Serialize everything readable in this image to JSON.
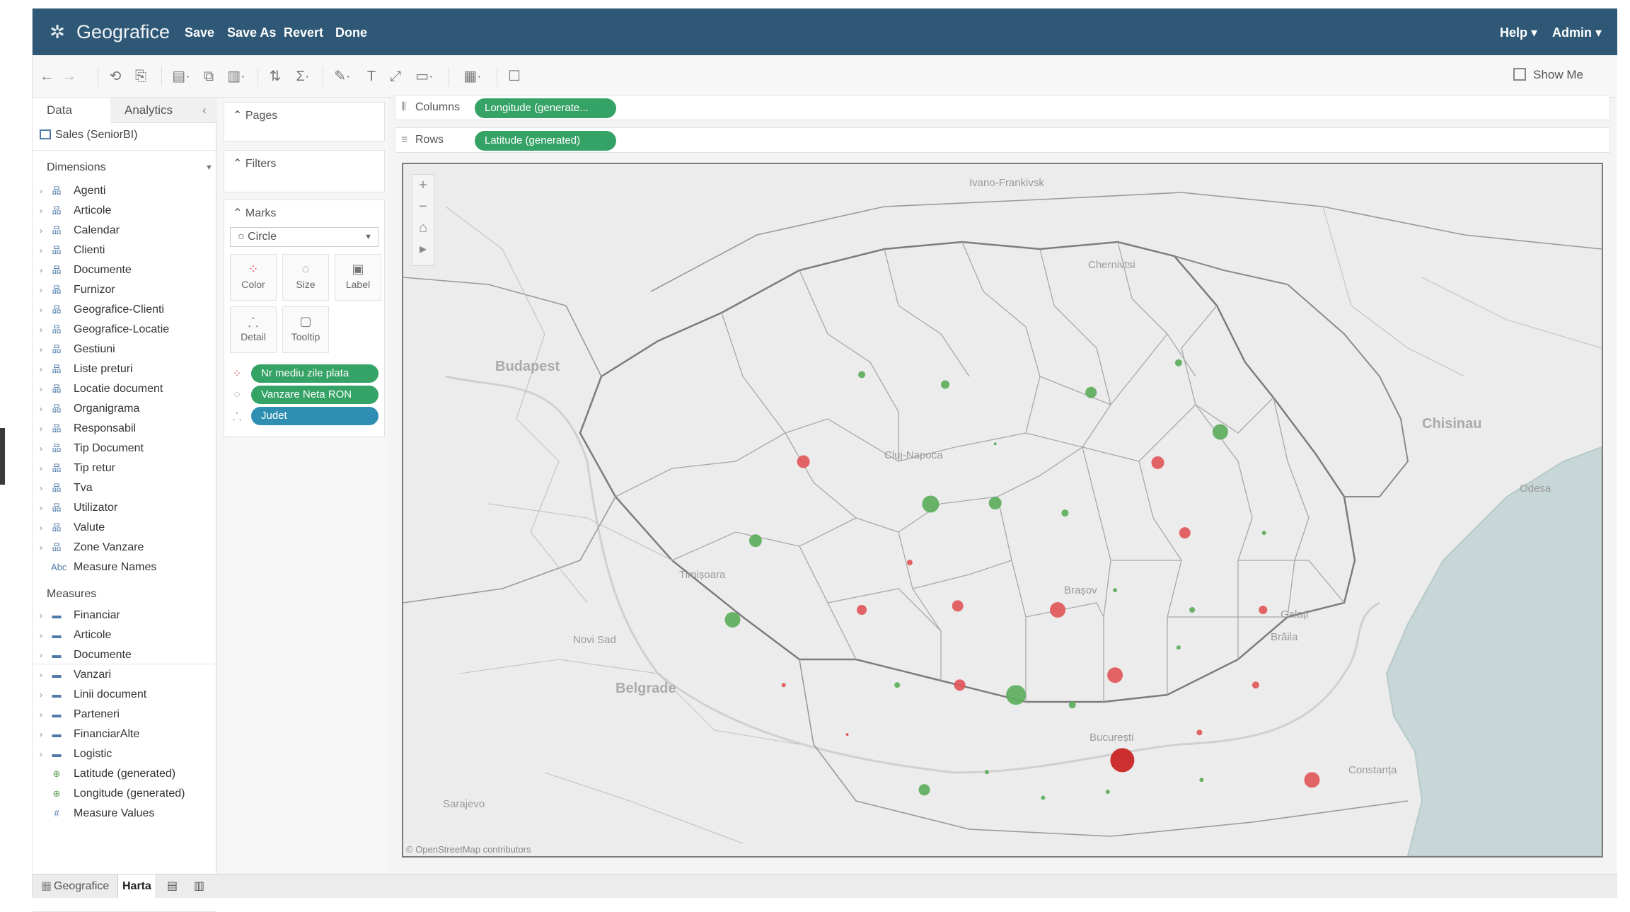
{
  "app": {
    "name": "Geografice",
    "menu": [
      "Save",
      "Save As",
      "Revert",
      "Done"
    ],
    "help": "Help ▾",
    "user": "Admin ▾"
  },
  "toolbar": {
    "show_me": "Show Me"
  },
  "data_pane": {
    "tabs": [
      "Data",
      "Analytics"
    ],
    "datasource": "Sales (SeniorBI)",
    "dimensions_header": "Dimensions",
    "dimensions": [
      "Agenti",
      "Articole",
      "Calendar",
      "Clienti",
      "Documente",
      "Furnizor",
      "Geografice-Clienti",
      "Geografice-Locatie",
      "Gestiuni",
      "Liste preturi",
      "Locatie document",
      "Organigrama",
      "Responsabil",
      "Tip Document",
      "Tip retur",
      "Tva",
      "Utilizator",
      "Valute",
      "Zone Vanzare",
      "Measure Names"
    ],
    "measures_header": "Measures",
    "measures": [
      "Financiar",
      "Articole",
      "Documente",
      "Vanzari",
      "Linii document",
      "Parteneri",
      "FinanciarAlte",
      "Logistic",
      "Latitude (generated)",
      "Longitude (generated)",
      "Measure Values"
    ]
  },
  "shelves": {
    "pages": "Pages",
    "filters": "Filters",
    "marks": "Marks",
    "mark_type": "Circle",
    "mark_buttons": [
      "Color",
      "Size",
      "Label",
      "Detail",
      "Tooltip"
    ],
    "mark_pills": [
      "Nr mediu zile plata",
      "Vanzare Neta RON",
      "Judet"
    ],
    "columns_label": "Columns",
    "columns_pill": "Longitude (generate...",
    "rows_label": "Rows",
    "rows_pill": "Latitude (generated)"
  },
  "map": {
    "labels": [
      "Ivano-Frankivsk",
      "Chernivtsi",
      "Budapest",
      "Cluj-Napoca",
      "Chisinau",
      "Odesa",
      "Timișoara",
      "Novi Sad",
      "Brașov",
      "Galați",
      "Brăila",
      "Belgrade",
      "București",
      "Constanța",
      "Sarajevo"
    ],
    "attribution": "© OpenStreetMap contributors",
    "zoom_in": "+",
    "zoom_out": "−",
    "colors": {
      "positive": "#5cae5c",
      "negative": "#e15759",
      "strong_negative": "#c81e1e",
      "sea": "#c7d7d8"
    }
  },
  "sheets": [
    "Geografice",
    "Harta"
  ]
}
